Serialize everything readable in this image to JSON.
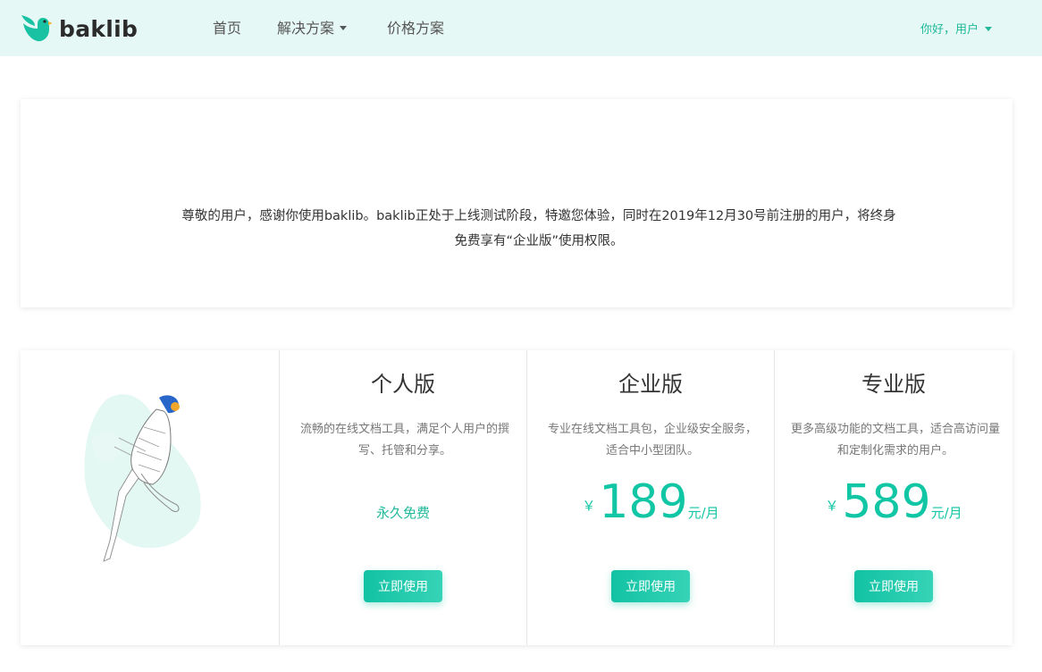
{
  "navbar": {
    "brand": "baklib",
    "items": [
      {
        "label": "首页"
      },
      {
        "label": "解决方案"
      },
      {
        "label": "价格方案"
      }
    ],
    "user_greeting": "你好，用户"
  },
  "notice": {
    "text": "尊敬的用户，感谢你使用baklib。baklib正处于上线测试阶段，特邀您体验，同时在2019年12月30号前注册的用户，将终身免费享有“企业版”使用权限。"
  },
  "plans": [
    {
      "name": "个人版",
      "description": "流畅的在线文档工具，满足个人用户的撰写、托管和分享。",
      "price_text": "永久免费",
      "button": "立即使用"
    },
    {
      "name": "企业版",
      "description": "专业在线文档工具包，企业级安全服务，适合中小型团队。",
      "currency": "￥",
      "amount": "189",
      "unit": "元/月",
      "button": "立即使用"
    },
    {
      "name": "专业版",
      "description": "更多高级功能的文档工具，适合高访问量和定制化需求的用户。",
      "currency": "￥",
      "amount": "589",
      "unit": "元/月",
      "button": "立即使用"
    }
  ],
  "colors": {
    "accent": "#11c6a4",
    "navbar_bg": "#e6f8f5",
    "text": "#333333"
  }
}
